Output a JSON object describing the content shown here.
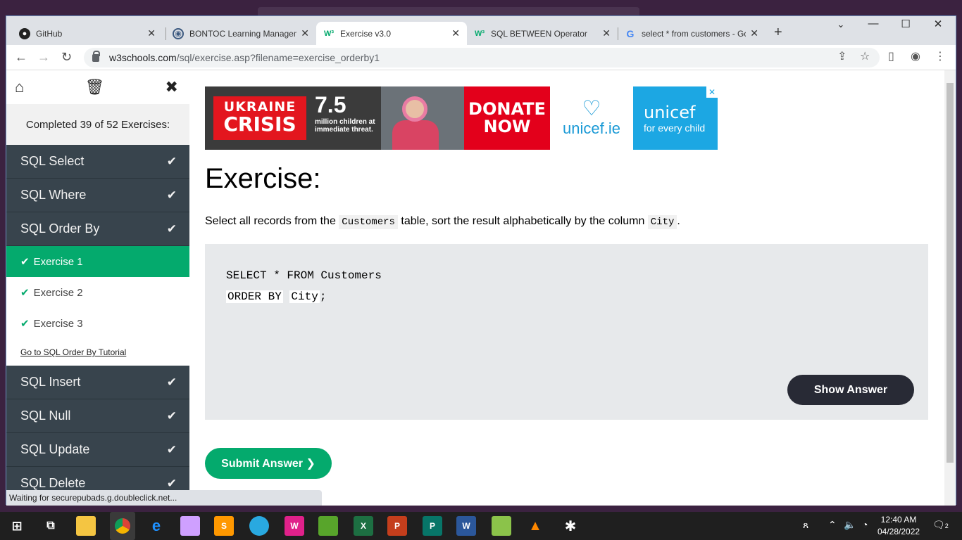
{
  "browser": {
    "tabs": [
      {
        "title": "GitHub",
        "icon": "github-icon"
      },
      {
        "title": "BONTOC Learning Managem",
        "icon": "moodle-icon"
      },
      {
        "title": "Exercise v3.0",
        "icon": "w3schools-icon"
      },
      {
        "title": "SQL BETWEEN Operator",
        "icon": "w3schools-icon"
      },
      {
        "title": "select * from customers - Go",
        "icon": "google-icon"
      }
    ],
    "active_tab": 2,
    "address": {
      "host": "w3schools.com",
      "path": "/sql/exercise.asp?filename=exercise_orderby1"
    },
    "status_text": "Waiting for securepubads.g.doubleclick.net..."
  },
  "sidebar": {
    "completed_text": "Completed 39 of 52 Exercises:",
    "categories_before": [
      {
        "label": "SQL Select"
      },
      {
        "label": "SQL Where"
      },
      {
        "label": "SQL Order By"
      }
    ],
    "exercises": [
      {
        "label": "Exercise 1",
        "active": true
      },
      {
        "label": "Exercise 2",
        "active": false
      },
      {
        "label": "Exercise 3",
        "active": false
      }
    ],
    "tutorial_link": "Go to SQL Order By Tutorial",
    "categories_after": [
      {
        "label": "SQL Insert"
      },
      {
        "label": "SQL Null"
      },
      {
        "label": "SQL Update"
      },
      {
        "label": "SQL Delete"
      }
    ]
  },
  "ad": {
    "badge_line1": "UKRAINE",
    "badge_line2": "CRISIS",
    "stat_number": "7.5",
    "stat_text": "million children at immediate threat.",
    "donate_line1": "DONATE",
    "donate_line2": "NOW",
    "site": "unicef.ie",
    "brand": "unicef",
    "tagline": "for every child"
  },
  "exercise": {
    "title": "Exercise:",
    "desc_before": "Select all records from the ",
    "desc_code1": "Customers",
    "desc_middle": " table, sort the result alphabetically by the column ",
    "desc_code2": "City",
    "desc_after": ".",
    "code_line1": "SELECT * FROM Customers",
    "code_fill1": "ORDER BY",
    "code_fill2": "City",
    "code_end": ";",
    "show_answer": "Show Answer",
    "submit": "Submit Answer ❯"
  },
  "taskbar": {
    "time": "12:40 AM",
    "date": "04/28/2022",
    "notifications": "2"
  },
  "colors": {
    "w3_green": "#04aa6d",
    "sidebar_dark": "#38444d",
    "desktop_purple": "#3b2240"
  }
}
